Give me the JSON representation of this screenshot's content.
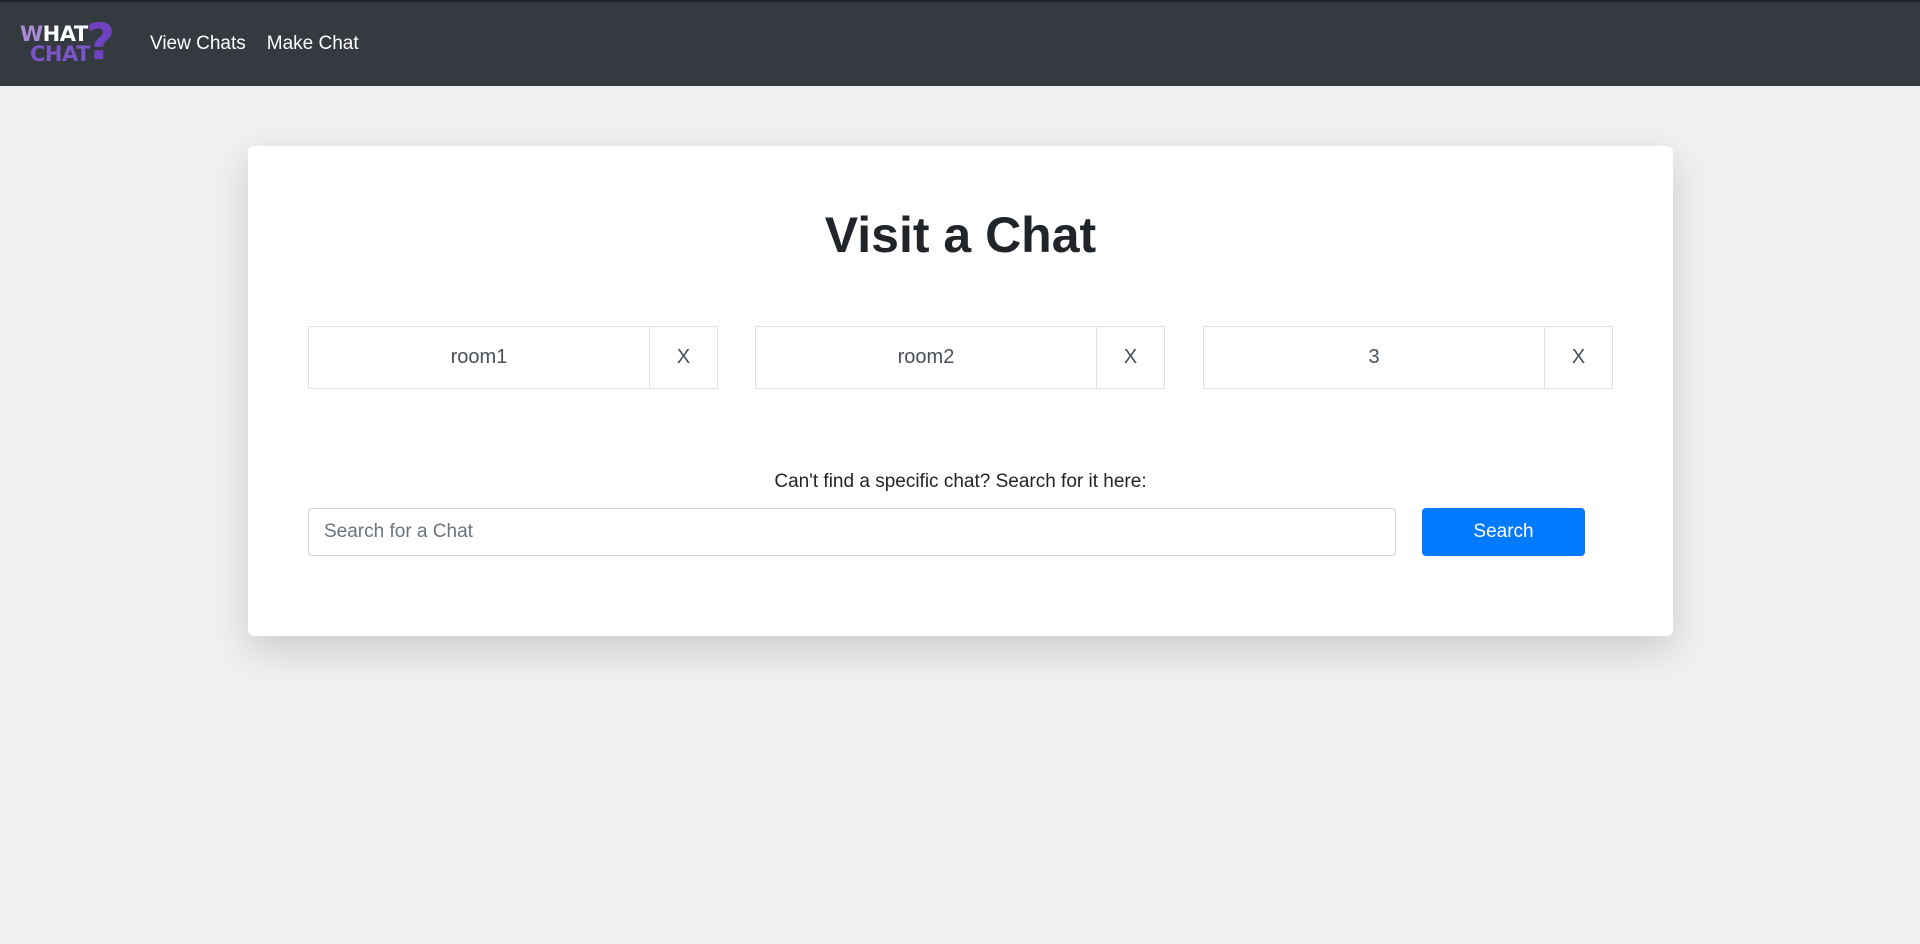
{
  "navbar": {
    "logo": {
      "line1": "WHAT",
      "line2": "CHAT",
      "mark": "?"
    },
    "links": [
      "View Chats",
      "Make Chat"
    ]
  },
  "main": {
    "title": "Visit a Chat",
    "rooms": [
      {
        "name": "room1",
        "remove_label": "X"
      },
      {
        "name": "room2",
        "remove_label": "X"
      },
      {
        "name": "3",
        "remove_label": "X"
      }
    ],
    "search": {
      "label": "Can't find a specific chat? Search for it here:",
      "placeholder": "Search for a Chat",
      "value": "",
      "button_label": "Search"
    }
  },
  "colors": {
    "navbar": "#343a40",
    "background": "#f1f1f1",
    "primary": "#007bff",
    "logo_purple": "#6f42c1"
  }
}
